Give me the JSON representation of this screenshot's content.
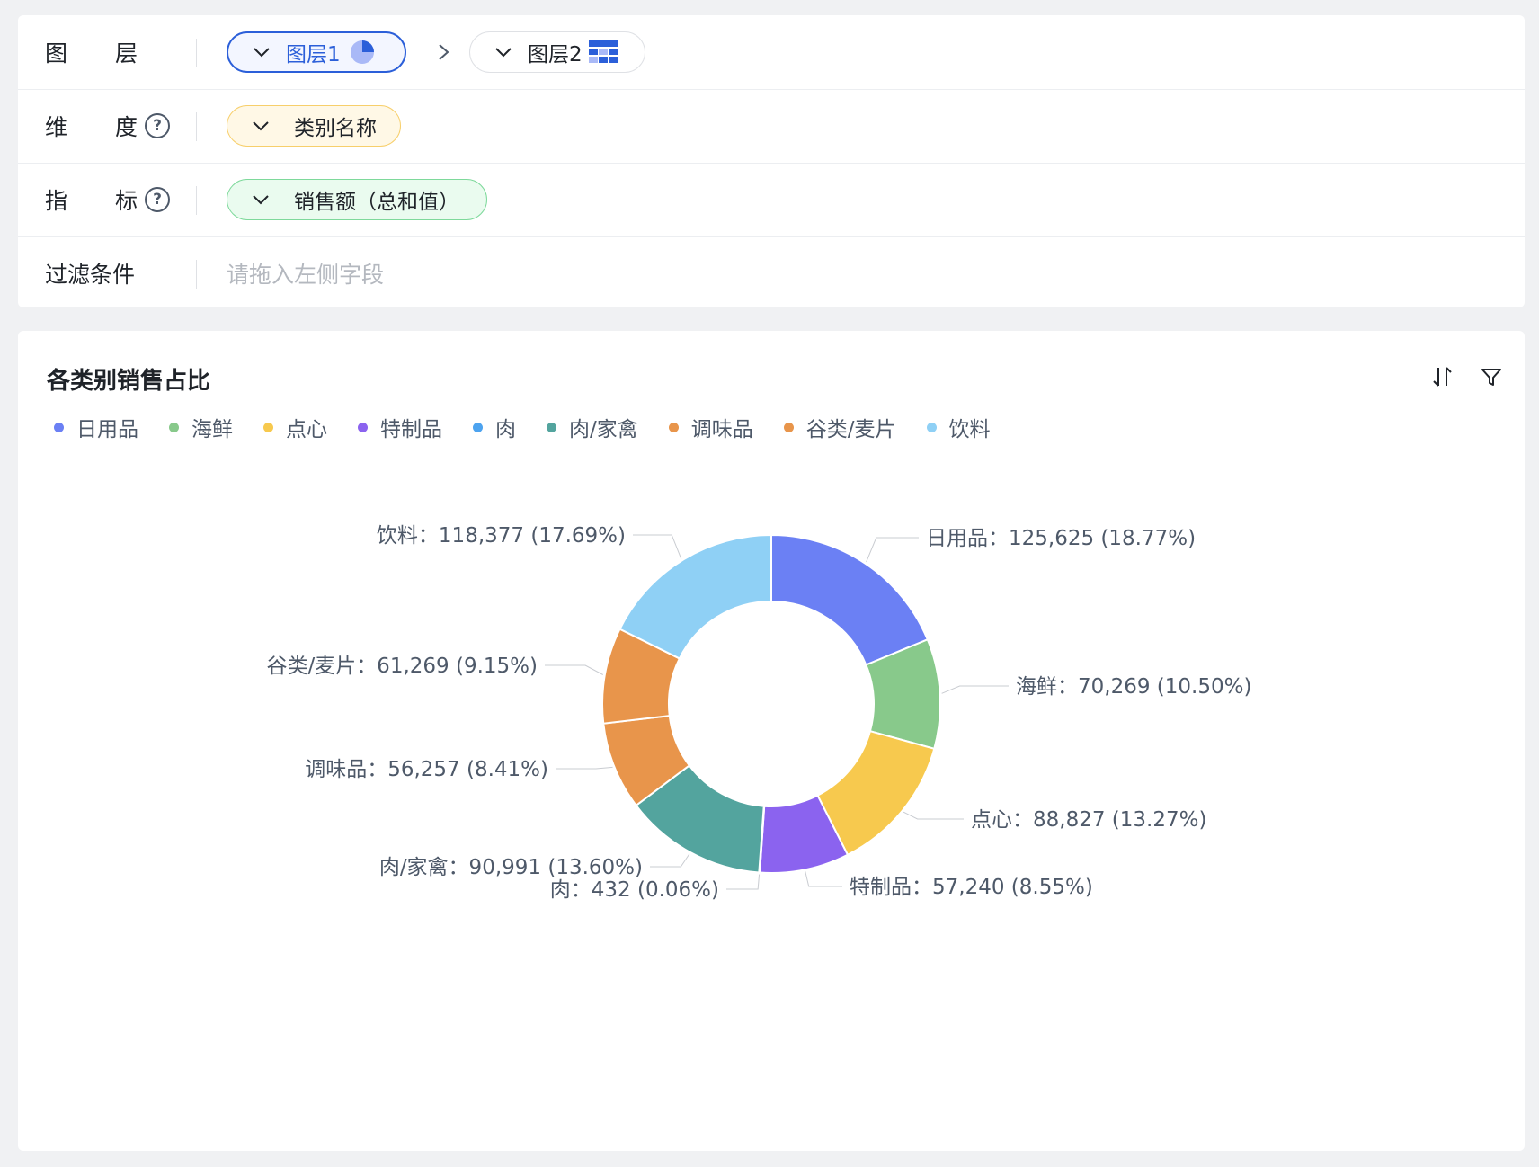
{
  "config": {
    "layer": {
      "label_a": "图",
      "label_b": "层",
      "layer1": "图层1",
      "layer2": "图层2",
      "arrow": ">"
    },
    "dimension": {
      "label_a": "维",
      "label_b": "度",
      "help": "?",
      "field": "类别名称"
    },
    "metric": {
      "label_a": "指",
      "label_b": "标",
      "help": "?",
      "field": "销售额（总和值）"
    },
    "filter": {
      "label": "过滤条件",
      "placeholder": "请拖入左侧字段"
    }
  },
  "toolbar_icons": [
    "sort-icon",
    "filter-icon"
  ],
  "colors": {
    "accent": "#2b5fd9",
    "dimension_bg": "#fff8e6",
    "dimension_border": "#f7cf6b",
    "metric_bg": "#eafbef",
    "metric_border": "#7ed99b"
  },
  "chart_data": {
    "type": "pie",
    "donut": true,
    "title": "各类别销售占比",
    "legend_position": "top-left",
    "slices": [
      {
        "name": "日用品",
        "value": 125625,
        "percent": "18.77%",
        "value_label": "125,625",
        "color": "#6b80f4"
      },
      {
        "name": "海鲜",
        "value": 70269,
        "percent": "10.50%",
        "value_label": "70,269",
        "color": "#88c98b"
      },
      {
        "name": "点心",
        "value": 88827,
        "percent": "13.27%",
        "value_label": "88,827",
        "color": "#f7c94e"
      },
      {
        "name": "特制品",
        "value": 57240,
        "percent": "8.55%",
        "value_label": "57,240",
        "color": "#8b63ef"
      },
      {
        "name": "肉",
        "value": 432,
        "percent": "0.06%",
        "value_label": "432",
        "color": "#4da3ef"
      },
      {
        "name": "肉/家禽",
        "value": 90991,
        "percent": "13.60%",
        "value_label": "90,991",
        "color": "#53a49e"
      },
      {
        "name": "调味品",
        "value": 56257,
        "percent": "8.41%",
        "value_label": "56,257",
        "color": "#e8954b"
      },
      {
        "name": "谷类/麦片",
        "value": 61269,
        "percent": "9.15%",
        "value_label": "61,269",
        "color": "#e8954b"
      },
      {
        "name": "饮料",
        "value": 118377,
        "percent": "17.69%",
        "value_label": "118,377",
        "color": "#8fd0f5"
      }
    ]
  }
}
